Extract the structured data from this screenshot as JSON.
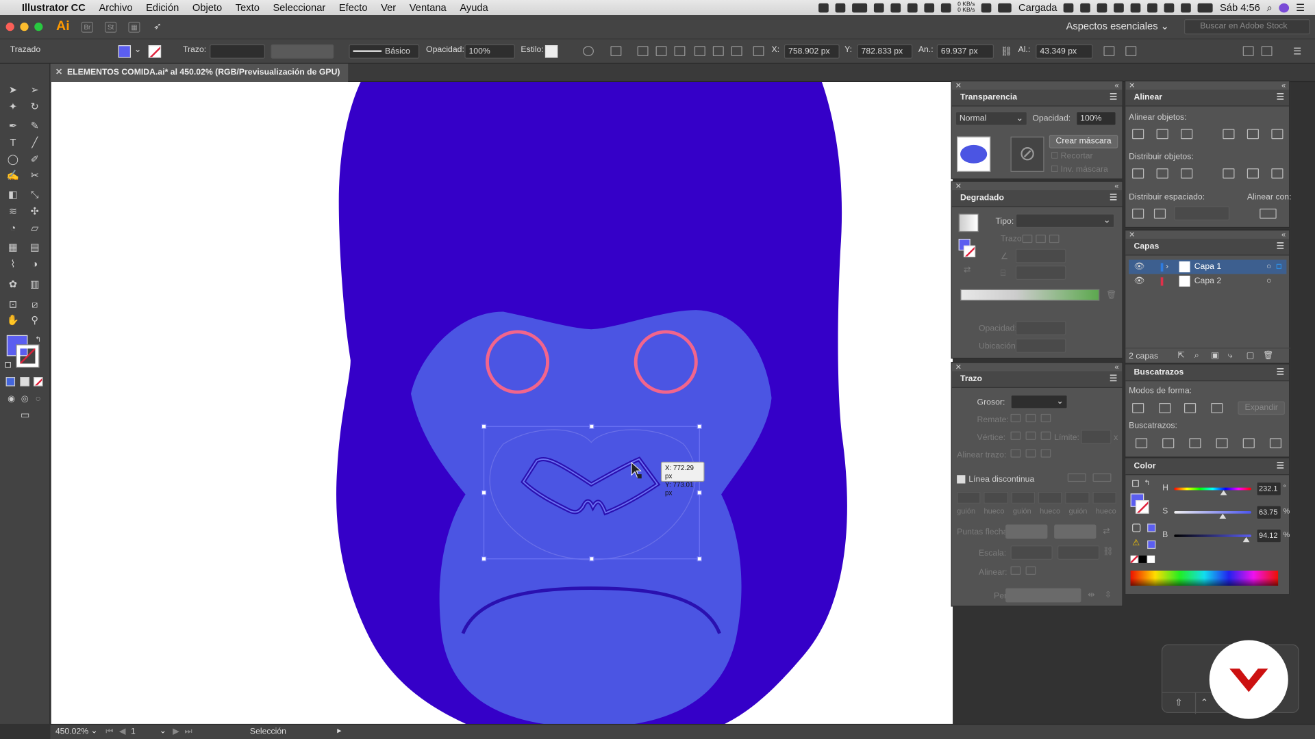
{
  "menubar": {
    "app": "Illustrator CC",
    "items": [
      "Archivo",
      "Edición",
      "Objeto",
      "Texto",
      "Seleccionar",
      "Efecto",
      "Ver",
      "Ventana",
      "Ayuda"
    ],
    "battery": "Cargada",
    "clock": "Sáb 4:56",
    "net_up": "0 KB/s",
    "net_down": "0 KB/s"
  },
  "appbar": {
    "logo": "Ai",
    "st": "St",
    "workspace": "Aspectos esenciales",
    "search_placeholder": "Buscar en Adobe Stock"
  },
  "control": {
    "selection": "Trazado",
    "stroke_label": "Trazo:",
    "brush": "Básico",
    "opacity_label": "Opacidad:",
    "opacity": "100%",
    "style_label": "Estilo:",
    "x_label": "X:",
    "x": "758.902 px",
    "y_label": "Y:",
    "y": "782.833 px",
    "w_label": "An.:",
    "w": "69.937 px",
    "h_label": "Al.:",
    "h": "43.349 px"
  },
  "document": {
    "tab": "ELEMENTOS COMIDA.ai* al 450.02% (RGB/Previsualización de GPU)",
    "tooltip_x": "X: 772.29 px",
    "tooltip_y": "Y: 773.01 px"
  },
  "colors": {
    "fill": "#5b5ef0",
    "head": "#3500c8",
    "face": "#4b55e3",
    "eyes": "#f2658c",
    "accent": "#2f8ce0"
  },
  "transparency": {
    "title": "Transparencia",
    "mode": "Normal",
    "opacity_label": "Opacidad:",
    "opacity": "100%",
    "make_mask": "Crear máscara",
    "clip": "Recortar",
    "invert": "Inv. máscara"
  },
  "gradient": {
    "title": "Degradado",
    "type_label": "Tipo:",
    "stroke_label": "Trazo:",
    "opacity_label": "Opacidad:",
    "location_label": "Ubicación:"
  },
  "stroke": {
    "title": "Trazo",
    "weight_label": "Grosor:",
    "cap_label": "Remate:",
    "corner_label": "Vértice:",
    "limit_label": "Límite:",
    "align_label": "Alinear trazo:",
    "dashed_label": "Línea discontinua",
    "dash_labels": [
      "guión",
      "hueco",
      "guión",
      "hueco",
      "guión",
      "hueco"
    ],
    "arrows_label": "Puntas flecha:",
    "scale_label": "Escala:",
    "align2_label": "Alinear:",
    "profile_label": "Perfil:",
    "limit_suffix": "x"
  },
  "align": {
    "title": "Alinear",
    "objects_label": "Alinear objetos:",
    "distribute_label": "Distribuir objetos:",
    "spacing_label": "Distribuir espaciado:",
    "align_to_label": "Alinear con:"
  },
  "layers": {
    "title": "Capas",
    "items": [
      {
        "name": "Capa 1",
        "color": "#2f7ce0"
      },
      {
        "name": "Capa 2",
        "color": "#e0304a"
      }
    ],
    "count": "2 capas"
  },
  "pathfinder": {
    "title": "Buscatrazos",
    "shape_modes_label": "Modos de forma:",
    "pathfinders_label": "Buscatrazos:",
    "expand": "Expandir"
  },
  "color": {
    "title": "Color",
    "h_label": "H",
    "h": "232.1",
    "h_unit": "°",
    "s_label": "S",
    "s": "63.75",
    "s_unit": "%",
    "b_label": "B",
    "b": "94.12",
    "b_unit": "%"
  },
  "status": {
    "zoom": "450.02%",
    "artboard": "1",
    "tool": "Selección"
  }
}
